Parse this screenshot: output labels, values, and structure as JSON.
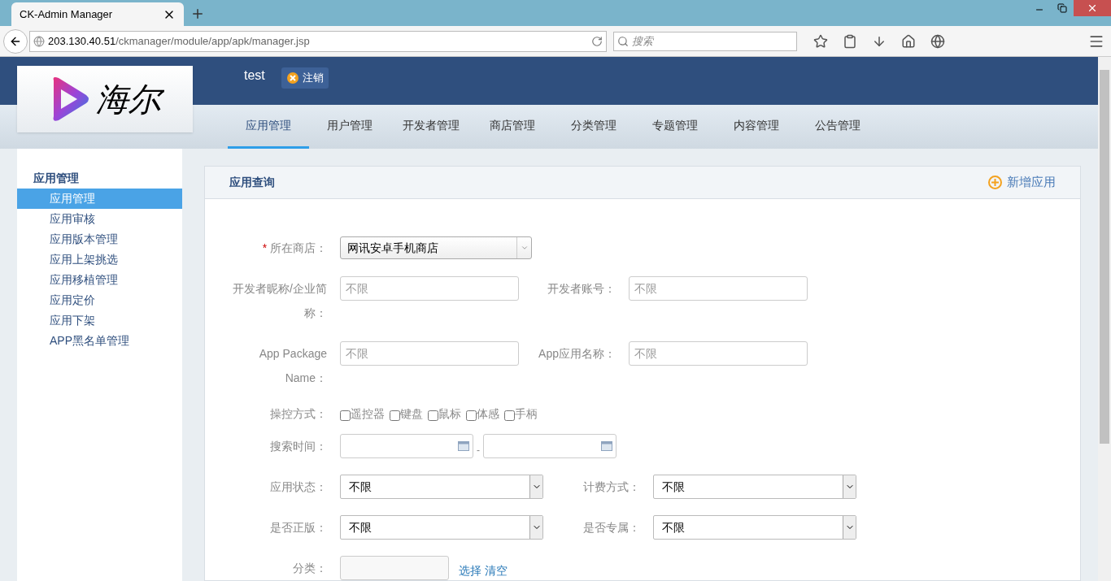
{
  "browser": {
    "tab_title": "CK-Admin Manager",
    "url_host": "203.130.40.51",
    "url_path": "/ckmanager/module/app/apk/manager.jsp",
    "search_placeholder": "搜索"
  },
  "header": {
    "logo_text": "海尔",
    "user": "test",
    "logout": "注销"
  },
  "nav": [
    {
      "label": "应用管理",
      "selected": true
    },
    {
      "label": "用户管理",
      "selected": false
    },
    {
      "label": "开发者管理",
      "selected": false
    },
    {
      "label": "商店管理",
      "selected": false
    },
    {
      "label": "分类管理",
      "selected": false
    },
    {
      "label": "专题管理",
      "selected": false
    },
    {
      "label": "内容管理",
      "selected": false
    },
    {
      "label": "公告管理",
      "selected": false
    }
  ],
  "sidebar": {
    "title": "应用管理",
    "items": [
      {
        "label": "应用管理",
        "selected": true
      },
      {
        "label": "应用审核",
        "selected": false
      },
      {
        "label": "应用版本管理",
        "selected": false
      },
      {
        "label": "应用上架挑选",
        "selected": false
      },
      {
        "label": "应用移植管理",
        "selected": false
      },
      {
        "label": "应用定价",
        "selected": false
      },
      {
        "label": "应用下架",
        "selected": false
      },
      {
        "label": "APP黑名单管理",
        "selected": false
      }
    ]
  },
  "panel": {
    "title": "应用查询",
    "add": "新增应用",
    "store": {
      "required": "*",
      "label": "所在商店：",
      "value": "网讯安卓手机商店"
    },
    "row1": [
      {
        "label": "开发者昵称/企业简称：",
        "placeholder": "不限"
      },
      {
        "label": "开发者账号：",
        "placeholder": "不限"
      }
    ],
    "row2": [
      {
        "label": "App Package Name：",
        "placeholder": "不限"
      },
      {
        "label": "App应用名称：",
        "placeholder": "不限"
      }
    ],
    "control": {
      "label": "操控方式：",
      "options": [
        {
          "label": "遥控器",
          "checked": false
        },
        {
          "label": "键盘",
          "checked": false
        },
        {
          "label": "鼠标",
          "checked": false
        },
        {
          "label": "体感",
          "checked": false
        },
        {
          "label": "手柄",
          "checked": false
        }
      ]
    },
    "time": {
      "label": "搜索时间：",
      "separator": "-"
    },
    "row3": [
      {
        "label": "应用状态：",
        "value": "不限"
      },
      {
        "label": "计费方式：",
        "value": "不限"
      }
    ],
    "row4": [
      {
        "label": "是否正版：",
        "value": "不限"
      },
      {
        "label": "是否专属：",
        "value": "不限"
      }
    ],
    "category": {
      "label": "分类：",
      "links": [
        "选择",
        "清空"
      ]
    }
  }
}
